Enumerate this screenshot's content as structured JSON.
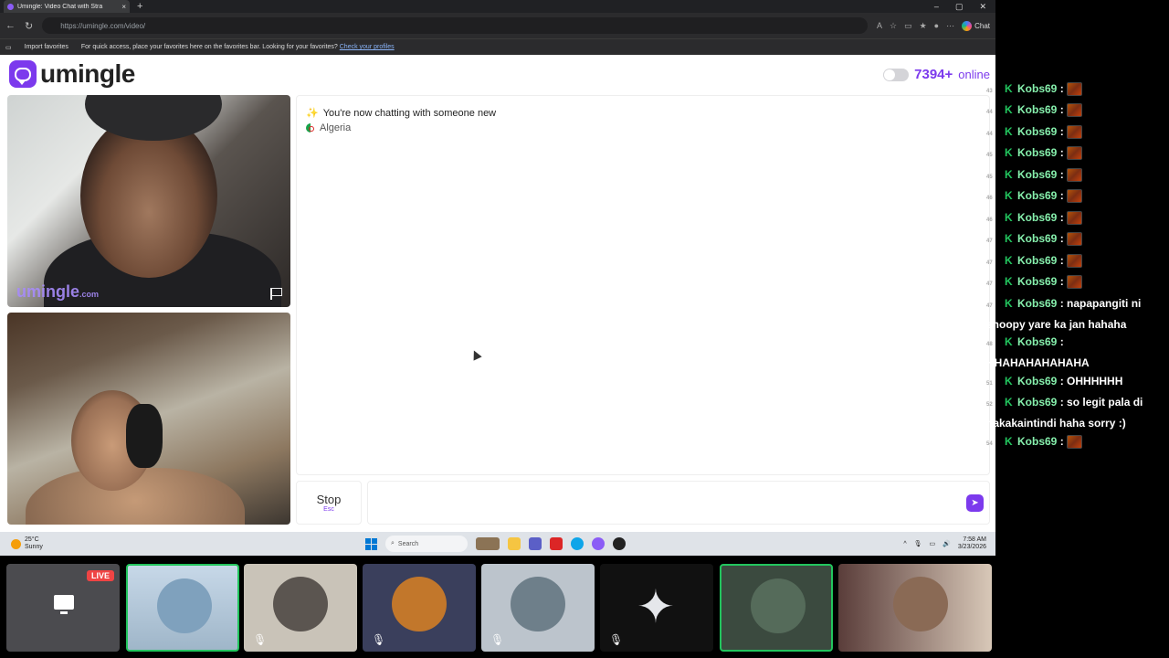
{
  "browser": {
    "tab_title": "Umingle: Video Chat with Stra",
    "new_tab": "+",
    "url": "https://umingle.com/video/",
    "chat_label": "Chat",
    "favorites": {
      "import_label": "Import favorites",
      "hint": "For quick access, place your favorites here on the favorites bar. Looking for your favorites?",
      "link": "Check your profiles"
    }
  },
  "site": {
    "logo_text": "umingle",
    "online_count": "7394+",
    "online_label": "online",
    "watermark": "umingle",
    "watermark_suffix": ".com"
  },
  "chat": {
    "status": "You're now chatting with someone new",
    "country": "Algeria",
    "stop_label": "Stop",
    "stop_key": "Esc"
  },
  "taskbar": {
    "temp": "25°C",
    "weather": "Sunny",
    "search_placeholder": "Search",
    "time": "7:58 AM",
    "date": "3/23/2026"
  },
  "strip": {
    "live_label": "LIVE"
  },
  "overlay": [
    {
      "ts": "43",
      "user": "Kobs69",
      "text": "",
      "emote": true
    },
    {
      "ts": "44",
      "user": "Kobs69",
      "text": "",
      "emote": true
    },
    {
      "ts": "44",
      "user": "Kobs69",
      "text": "",
      "emote": true
    },
    {
      "ts": "45",
      "user": "Kobs69",
      "text": "",
      "emote": true
    },
    {
      "ts": "45",
      "user": "Kobs69",
      "text": "",
      "emote": true
    },
    {
      "ts": "46",
      "user": "Kobs69",
      "text": "",
      "emote": true
    },
    {
      "ts": "46",
      "user": "Kobs69",
      "text": "",
      "emote": true
    },
    {
      "ts": "47",
      "user": "Kobs69",
      "text": "",
      "emote": true
    },
    {
      "ts": "47",
      "user": "Kobs69",
      "text": "",
      "emote": true
    },
    {
      "ts": "47",
      "user": "Kobs69",
      "text": "",
      "emote": true
    },
    {
      "ts": "47",
      "user": "Kobs69",
      "text": "napapangiti ni snoopy yare ka jan hahaha",
      "emote": false
    },
    {
      "ts": "48",
      "user": "Kobs69",
      "text": "HHAHAHAHAHAHA",
      "emote": false
    },
    {
      "ts": "51",
      "user": "Kobs69",
      "text": "OHHHHHH",
      "emote": false
    },
    {
      "ts": "52",
      "user": "Kobs69",
      "text": "so legit pala di nakakaintindi haha sorry :)",
      "emote": false
    },
    {
      "ts": "54",
      "user": "Kobs69",
      "text": "",
      "emote": true
    }
  ]
}
